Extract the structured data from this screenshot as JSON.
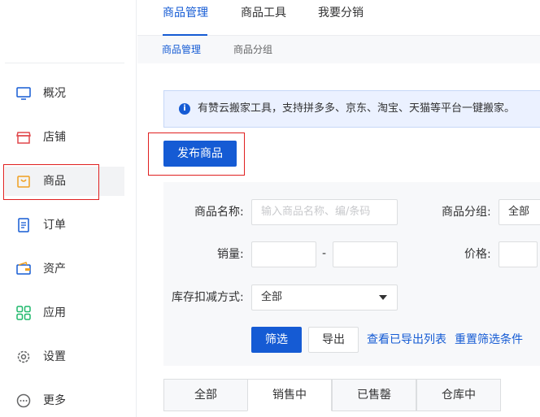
{
  "sidebar": {
    "items": [
      {
        "label": "概况",
        "icon": "monitor-icon"
      },
      {
        "label": "店铺",
        "icon": "store-icon"
      },
      {
        "label": "商品",
        "icon": "shopping-bag-icon"
      },
      {
        "label": "订单",
        "icon": "order-list-icon"
      },
      {
        "label": "资产",
        "icon": "wallet-icon"
      },
      {
        "label": "应用",
        "icon": "apps-grid-icon"
      },
      {
        "label": "设置",
        "icon": "gear-icon"
      },
      {
        "label": "更多",
        "icon": "more-dots-icon"
      }
    ]
  },
  "top_tabs": [
    "商品管理",
    "商品工具",
    "我要分销"
  ],
  "sub_tabs": [
    "商品管理",
    "商品分组"
  ],
  "notice": {
    "icon": "info-icon",
    "text": "有赞云搬家工具，支持拼多多、京东、淘宝、天猫等平台一键搬家。"
  },
  "publish_button": "发布商品",
  "filters": {
    "name_label": "商品名称:",
    "name_placeholder": "输入商品名称、编/条码",
    "group_label": "商品分组:",
    "group_value": "全部",
    "sales_label": "销量:",
    "sales_dash": "-",
    "price_label": "价格:",
    "stock_label": "库存扣减方式:",
    "stock_value": "全部",
    "filter_button": "筛选",
    "export_button": "导出",
    "view_exported_link": "查看已导出列表",
    "reset_link": "重置筛选条件"
  },
  "status_tabs": [
    "全部",
    "销售中",
    "已售罄",
    "仓库中"
  ],
  "colors": {
    "accent": "#155bd4",
    "highlight_box": "#e02020"
  }
}
